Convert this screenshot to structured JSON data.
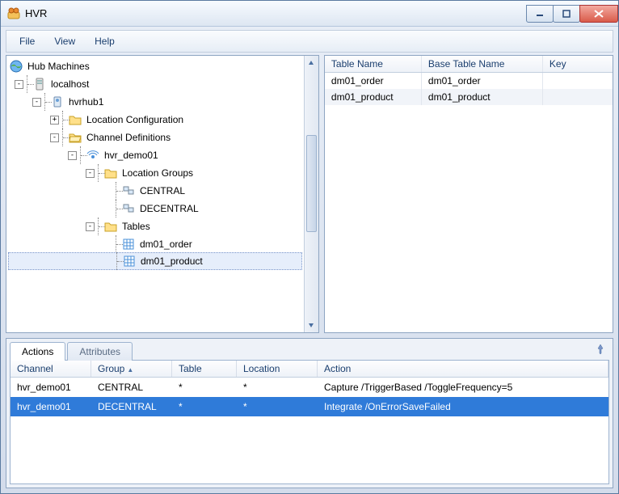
{
  "window": {
    "title": "HVR"
  },
  "menu": {
    "file": "File",
    "view": "View",
    "help": "Help"
  },
  "tree": {
    "root": "Hub Machines",
    "host": "localhost",
    "hub": "hvrhub1",
    "locconf": "Location Configuration",
    "chandef": "Channel Definitions",
    "channel": "hvr_demo01",
    "locgroups": "Location Groups",
    "lg1": "CENTRAL",
    "lg2": "DECENTRAL",
    "tables": "Tables",
    "t1": "dm01_order",
    "t2": "dm01_product"
  },
  "table_list": {
    "headers": {
      "tn": "Table Name",
      "btn": "Base Table Name",
      "key": "Key"
    },
    "rows": [
      {
        "tn": "dm01_order",
        "btn": "dm01_order",
        "key": ""
      },
      {
        "tn": "dm01_product",
        "btn": "dm01_product",
        "key": ""
      }
    ]
  },
  "tabs": {
    "actions": "Actions",
    "attributes": "Attributes"
  },
  "actions_grid": {
    "headers": {
      "channel": "Channel",
      "group": "Group",
      "table": "Table",
      "location": "Location",
      "action": "Action"
    },
    "rows": [
      {
        "channel": "hvr_demo01",
        "group": "CENTRAL",
        "table": "*",
        "location": "*",
        "action": "Capture /TriggerBased /ToggleFrequency=5"
      },
      {
        "channel": "hvr_demo01",
        "group": "DECENTRAL",
        "table": "*",
        "location": "*",
        "action": "Integrate /OnErrorSaveFailed"
      }
    ],
    "selected_index": 1
  }
}
